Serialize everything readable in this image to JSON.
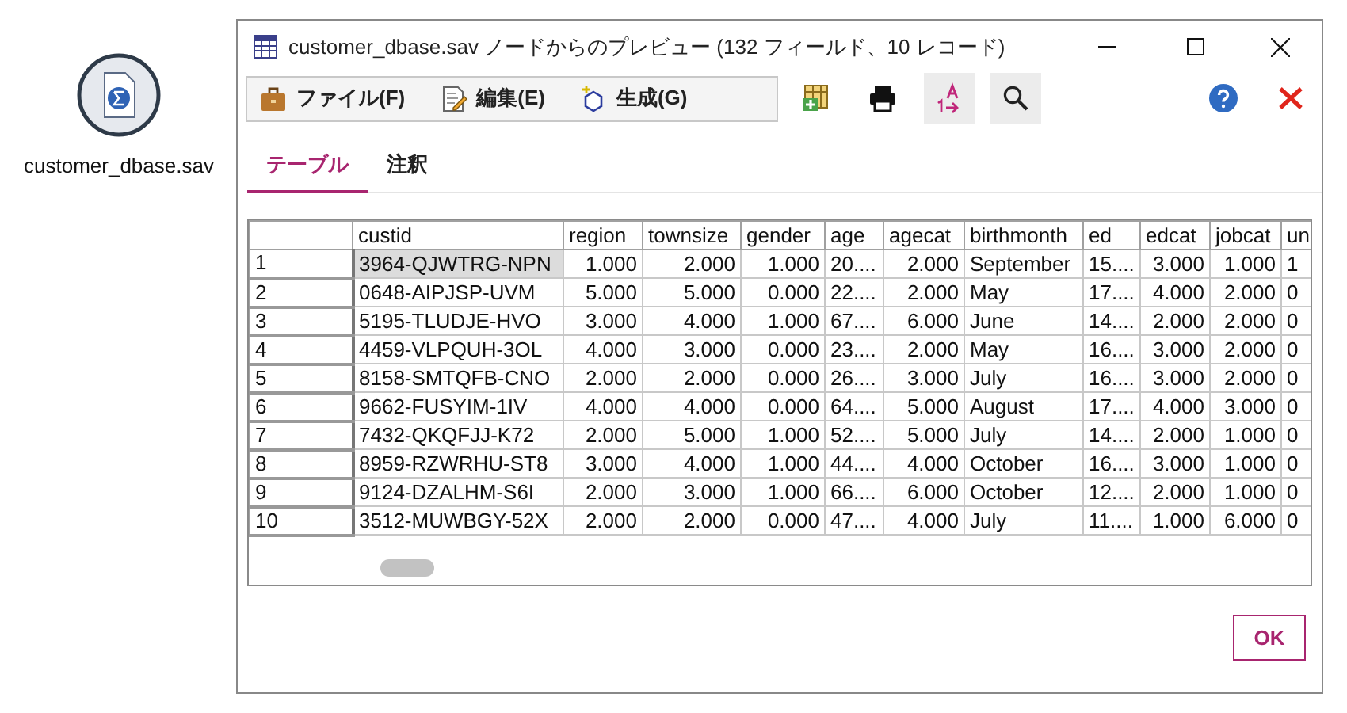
{
  "desktop_icon": {
    "label": "customer_dbase.sav"
  },
  "window": {
    "title": "customer_dbase.sav ノードからのプレビュー (132 フィールド、10 レコード)"
  },
  "menu": [
    {
      "label": "ファイル(F)",
      "kind": "file"
    },
    {
      "label": "編集(E)",
      "kind": "edit"
    },
    {
      "label": "生成(G)",
      "kind": "generate"
    }
  ],
  "tabs": [
    {
      "label": "テーブル",
      "selected": true
    },
    {
      "label": "注釈",
      "selected": false
    }
  ],
  "table": {
    "columns": [
      "custid",
      "region",
      "townsize",
      "gender",
      "age",
      "agecat",
      "birthmonth",
      "ed",
      "edcat",
      "jobcat",
      "un"
    ],
    "rows": [
      {
        "label": "1",
        "selected": true,
        "cells": [
          "3964-QJWTRG-NPN",
          "1.000",
          "2.000",
          "1.000",
          "20....",
          "2.000",
          "September",
          "15....",
          "3.000",
          "1.000",
          "1"
        ]
      },
      {
        "label": "2",
        "selected": false,
        "cells": [
          "0648-AIPJSP-UVM",
          "5.000",
          "5.000",
          "0.000",
          "22....",
          "2.000",
          "May",
          "17....",
          "4.000",
          "2.000",
          "0"
        ]
      },
      {
        "label": "3",
        "selected": false,
        "cells": [
          "5195-TLUDJE-HVO",
          "3.000",
          "4.000",
          "1.000",
          "67....",
          "6.000",
          "June",
          "14....",
          "2.000",
          "2.000",
          "0"
        ]
      },
      {
        "label": "4",
        "selected": false,
        "cells": [
          "4459-VLPQUH-3OL",
          "4.000",
          "3.000",
          "0.000",
          "23....",
          "2.000",
          "May",
          "16....",
          "3.000",
          "2.000",
          "0"
        ]
      },
      {
        "label": "5",
        "selected": false,
        "cells": [
          "8158-SMTQFB-CNO",
          "2.000",
          "2.000",
          "0.000",
          "26....",
          "3.000",
          "July",
          "16....",
          "3.000",
          "2.000",
          "0"
        ]
      },
      {
        "label": "6",
        "selected": false,
        "cells": [
          "9662-FUSYIM-1IV",
          "4.000",
          "4.000",
          "0.000",
          "64....",
          "5.000",
          "August",
          "17....",
          "4.000",
          "3.000",
          "0"
        ]
      },
      {
        "label": "7",
        "selected": false,
        "cells": [
          "7432-QKQFJJ-K72",
          "2.000",
          "5.000",
          "1.000",
          "52....",
          "5.000",
          "July",
          "14....",
          "2.000",
          "1.000",
          "0"
        ]
      },
      {
        "label": "8",
        "selected": false,
        "cells": [
          "8959-RZWRHU-ST8",
          "3.000",
          "4.000",
          "1.000",
          "44....",
          "4.000",
          "October",
          "16....",
          "3.000",
          "1.000",
          "0"
        ]
      },
      {
        "label": "9",
        "selected": false,
        "cells": [
          "9124-DZALHM-S6I",
          "2.000",
          "3.000",
          "1.000",
          "66....",
          "6.000",
          "October",
          "12....",
          "2.000",
          "1.000",
          "0"
        ]
      },
      {
        "label": "10",
        "selected": false,
        "cells": [
          "3512-MUWBGY-52X",
          "2.000",
          "2.000",
          "0.000",
          "47....",
          "4.000",
          "July",
          "11....",
          "1.000",
          "6.000",
          "0"
        ]
      }
    ]
  },
  "buttons": [
    {
      "label": "OK"
    }
  ]
}
